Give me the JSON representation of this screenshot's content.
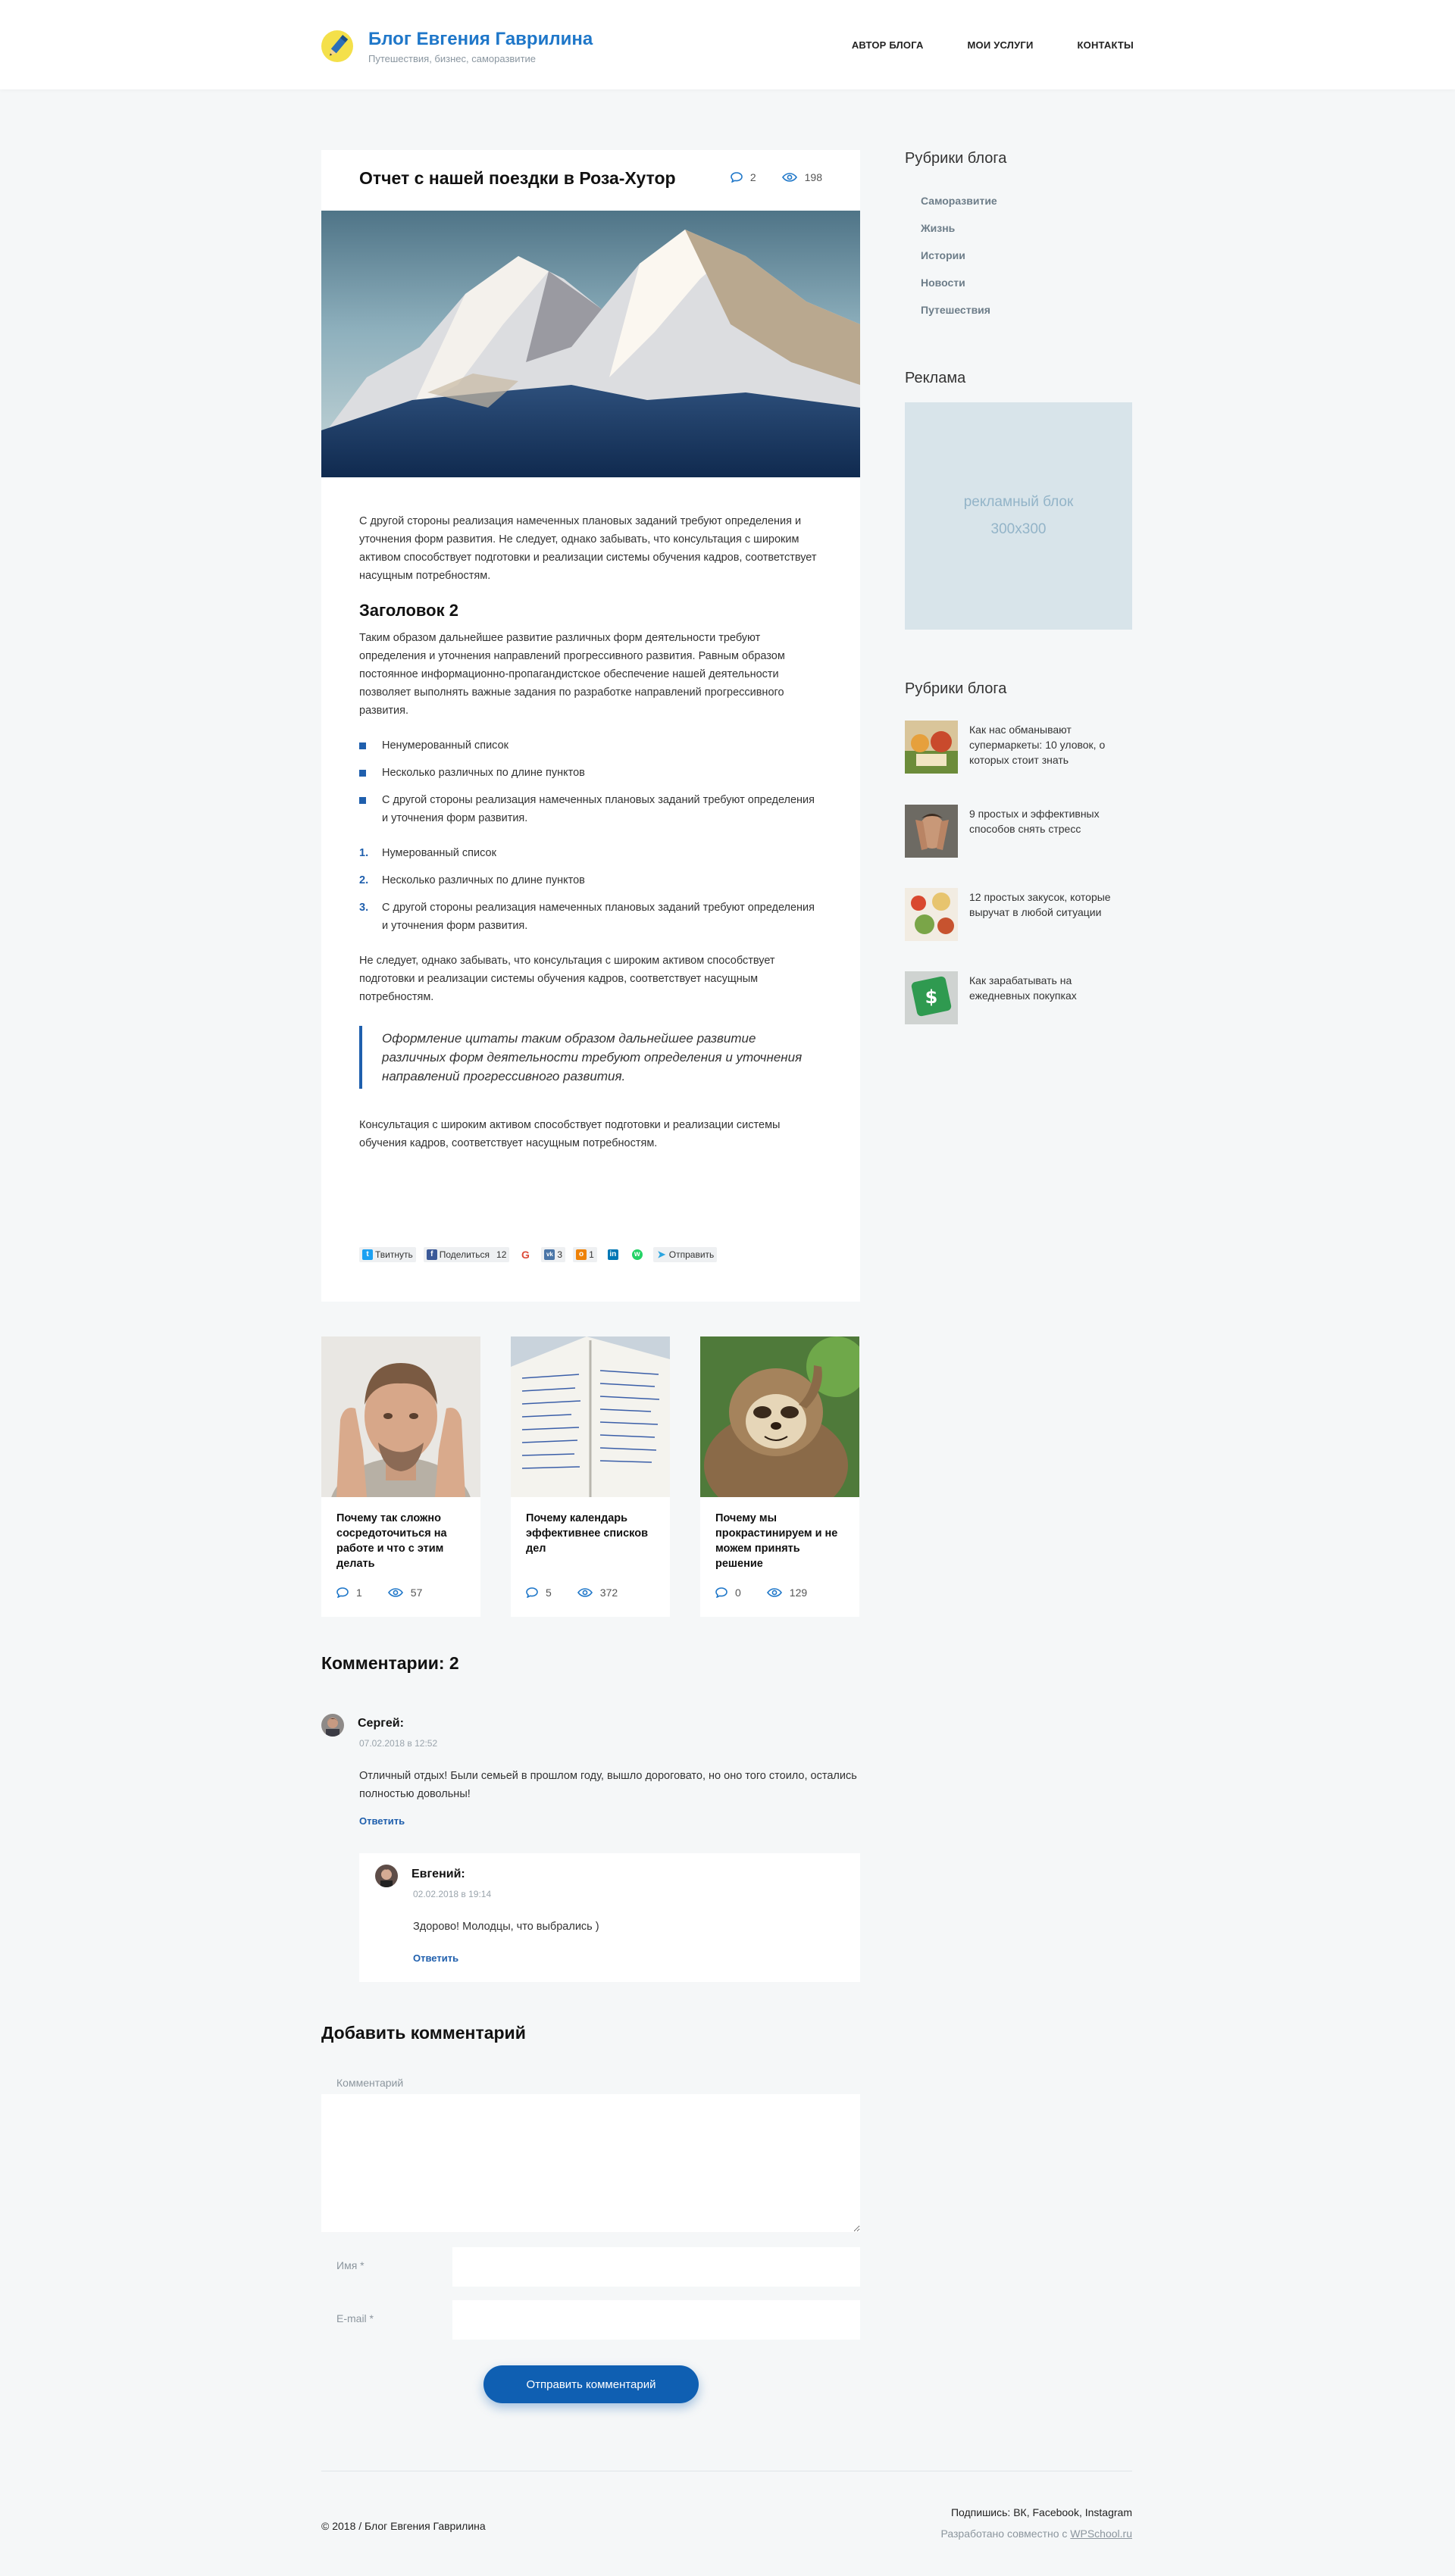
{
  "header": {
    "site_title": "Блог Евгения Гаврилина",
    "site_subtitle": "Путешествия, бизнес, саморазвитие",
    "nav": [
      "АВТОР БЛОГА",
      "МОИ УСЛУГИ",
      "КОНТАКТЫ"
    ]
  },
  "article": {
    "title": "Отчет с нашей поездки в Роза-Хутор",
    "comments_count": "2",
    "views_count": "198",
    "p1": "С другой стороны реализация намеченных плановых заданий требуют определения и уточнения форм развития. Не следует, однако забывать, что консультация с широким активом способствует подготовки и реализации системы обучения кадров, соответствует насущным потребностям.",
    "h2": "Заголовок 2",
    "p2": "Таким образом дальнейшее развитие различных форм деятельности требуют определения и уточнения направлений прогрессивного развития. Равным образом постоянное информационно-пропагандистское обеспечение нашей деятельности позволяет выполнять важные задания по разработке направлений прогрессивного развития.",
    "ul": [
      "Ненумерованный список",
      "Несколько различных по длине пунктов",
      "С другой стороны реализация намеченных плановых заданий требуют определения и уточнения форм развития."
    ],
    "ol": [
      {
        "n": "1.",
        "text": "Нумерованный список"
      },
      {
        "n": "2.",
        "text": "Несколько различных по длине пунктов"
      },
      {
        "n": "3.",
        "text": "С другой стороны реализация намеченных плановых заданий требуют определения и уточнения форм развития."
      }
    ],
    "p3": "Не следует, однако забывать, что консультация с широким активом способствует подготовки и реализации системы обучения кадров, соответствует насущным потребностям.",
    "quote": "Оформление цитаты таким образом дальнейшее развитие различных форм деятельности требуют определения и уточнения направлений прогрессивного развития.",
    "p4": "Консультация с широким активом способствует подготовки и реализации системы обучения кадров, соответствует насущным потребностям.",
    "share": {
      "twitter": "Твитнуть",
      "facebook": "Поделиться",
      "facebook_count": "12",
      "vk_count": "3",
      "ok_count": "1",
      "telegram": "Отправить"
    }
  },
  "related": [
    {
      "title": "Почему так сложно сосредоточиться на работе и что с этим делать",
      "comments": "1",
      "views": "57"
    },
    {
      "title": "Почему календарь эффективнее списков дел",
      "comments": "5",
      "views": "372"
    },
    {
      "title": "Почему мы прокрастинируем и не можем принять решение",
      "comments": "0",
      "views": "129"
    }
  ],
  "comments": {
    "title": "Комментарии: 2",
    "items": [
      {
        "name": "Сергей:",
        "date": "07.02.2018 в 12:52",
        "text": "Отличный отдых! Были семьей в прошлом году, вышло дороговато, но оно того стоило, остались полностью довольны!",
        "reply": "Ответить"
      },
      {
        "name": "Евгений:",
        "date": "02.02.2018 в 19:14",
        "text": "Здорово! Молодцы, что выбрались )",
        "reply": "Ответить"
      }
    ]
  },
  "form": {
    "title": "Добавить комментарий",
    "comment_label": "Комментарий",
    "name_label": "Имя *",
    "email_label": "E-mail *",
    "submit": "Отправить комментарий"
  },
  "sidebar": {
    "categories_title": "Рубрики блога",
    "categories": [
      "Саморазвитие",
      "Жизнь",
      "Истории",
      "Новости",
      "Путешествия"
    ],
    "ad_title": "Реклама",
    "ad_text1": "рекламный блок",
    "ad_text2": "300x300",
    "posts_title": "Рубрики блога",
    "posts": [
      "Как нас обманывают супермаркеты: 10 уловок, о которых стоит знать",
      "9 простых и эффективных способов снять стресс",
      "12 простых закусок, которые выручат в любой ситуации",
      "Как зарабатывать на ежедневных покупках"
    ]
  },
  "footer": {
    "copyright": "© 2018 / Блог Евгения Гаврилина",
    "subscribe": "Подпишись: ВК, Facebook, Instagram",
    "dev_prefix": "Разработано совместно с ",
    "dev_link": "WPSchool.ru"
  },
  "colors": {
    "accent": "#1f77c9",
    "button": "#0f5fb2",
    "background": "#f5f7f8",
    "ad_block": "#d8e4ea"
  }
}
